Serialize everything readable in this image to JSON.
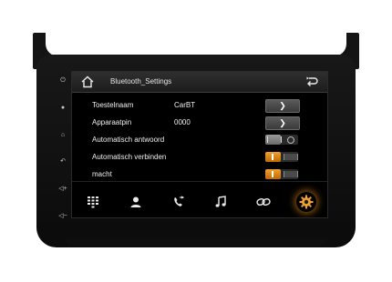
{
  "header": {
    "title": "Bluetooth_Settings"
  },
  "rows": [
    {
      "label": "Toestelnaam",
      "value": "CarBT"
    },
    {
      "label": "Apparaatpin",
      "value": "0000"
    },
    {
      "label": "Automatisch antwoord"
    },
    {
      "label": "Automatisch verbinden"
    },
    {
      "label": "macht"
    }
  ],
  "toggles": {
    "auto_answer": "off",
    "auto_connect": "on",
    "power": "on"
  },
  "dock": {
    "items": [
      "dialpad-icon",
      "contacts-icon",
      "call-log-icon",
      "music-icon",
      "link-icon",
      "settings-icon"
    ],
    "active": "settings-icon"
  },
  "colors": {
    "accent": "#f0a030",
    "screen_bg": "#000000"
  }
}
